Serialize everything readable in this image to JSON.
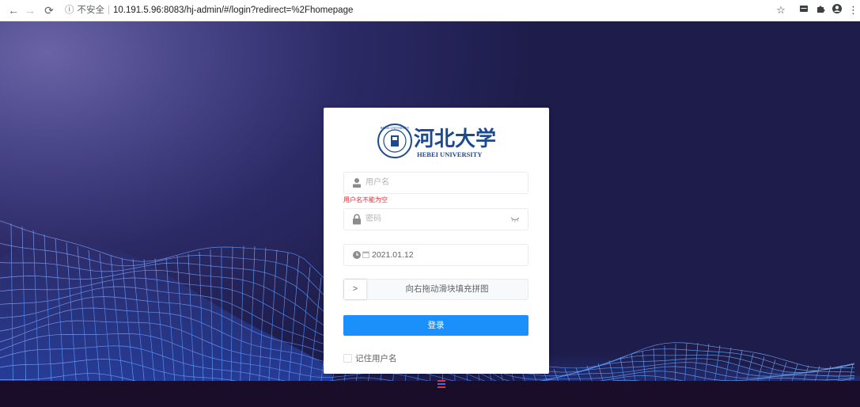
{
  "browser": {
    "security_label": "不安全",
    "url": "10.191.5.96:8083/hj-admin/#/login?redirect=%2Fhomepage",
    "icons": [
      "back-icon",
      "forward-icon",
      "reload-icon",
      "info-icon",
      "star-icon",
      "extension-icon",
      "puzzle-icon",
      "profile-icon",
      "menu-icon"
    ]
  },
  "login": {
    "logo": {
      "name_cn": "河北大学",
      "name_en": "HEBEI UNIVERSITY",
      "seal_text": "HEBEI UNIVERSITY"
    },
    "username": {
      "placeholder": "用户名",
      "error": "用户名不能为空"
    },
    "password": {
      "placeholder": "密码"
    },
    "date": {
      "value": "2021.01.12"
    },
    "captcha": {
      "hint": "向右拖动滑块填充拼图",
      "handle_glyph": ">"
    },
    "submit_label": "登录",
    "remember_label": "记住用户名",
    "colors": {
      "primary": "#1b90fa",
      "error": "#f5222d"
    }
  }
}
